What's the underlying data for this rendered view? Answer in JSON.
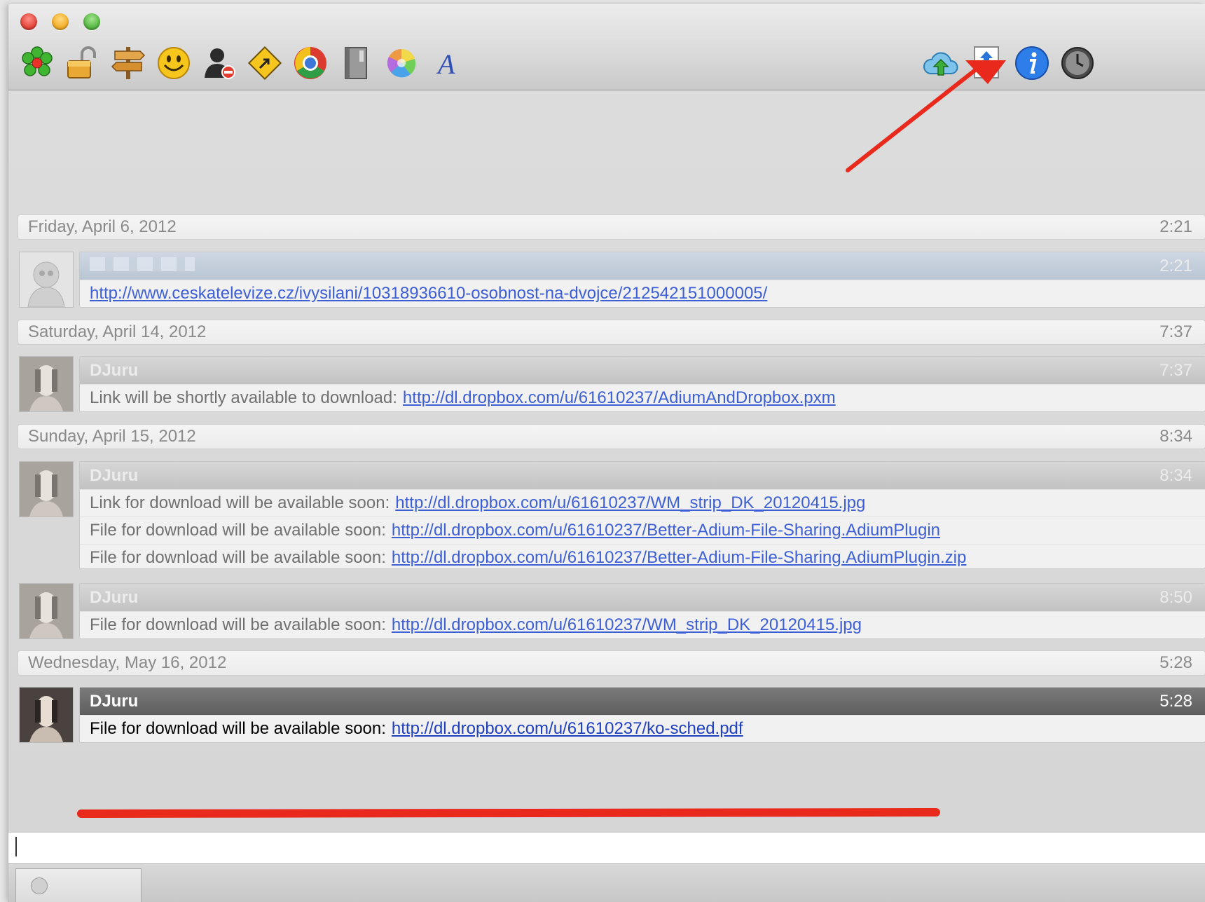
{
  "toolbar": {
    "left_icons": [
      "icq-flower-icon",
      "lock-icon",
      "signpost-icon",
      "smiley-icon",
      "block-contact-icon",
      "direction-sign-icon",
      "chrome-icon",
      "book-icon",
      "color-wheel-icon",
      "font-icon"
    ],
    "right_icons": [
      "cloud-upload-icon",
      "send-file-icon",
      "info-icon",
      "clock-icon"
    ]
  },
  "days": [
    {
      "date": "Friday, April 6, 2012",
      "time": "2:21"
    },
    {
      "date": "Saturday, April 14, 2012",
      "time": "7:37"
    },
    {
      "date": "Sunday, April 15, 2012",
      "time": "8:34"
    },
    {
      "date": "Wednesday, May 16, 2012",
      "time": "5:28"
    }
  ],
  "messages": [
    {
      "sender": "",
      "time": "2:21",
      "lines": [
        {
          "prefix": "",
          "link": "http://www.ceskatelevize.cz/ivysilani/10318936610-osobnost-na-dvojce/212542151000005/"
        }
      ]
    },
    {
      "sender": "DJuru",
      "time": "7:37",
      "lines": [
        {
          "prefix": "Link will be shortly available to download:",
          "link": "http://dl.dropbox.com/u/61610237/AdiumAndDropbox.pxm"
        }
      ]
    },
    {
      "sender": "DJuru",
      "time": "8:34",
      "lines": [
        {
          "prefix": "Link for download will be available soon:",
          "link": "http://dl.dropbox.com/u/61610237/WM_strip_DK_20120415.jpg"
        },
        {
          "prefix": "File for download will be available soon:",
          "link": "http://dl.dropbox.com/u/61610237/Better-Adium-File-Sharing.AdiumPlugin"
        },
        {
          "prefix": "File for download will be available soon:",
          "link": "http://dl.dropbox.com/u/61610237/Better-Adium-File-Sharing.AdiumPlugin.zip"
        }
      ]
    },
    {
      "sender": "DJuru",
      "time": "8:50",
      "lines": [
        {
          "prefix": "File for download will be available soon:",
          "link": "http://dl.dropbox.com/u/61610237/WM_strip_DK_20120415.jpg"
        }
      ]
    },
    {
      "sender": "DJuru",
      "time": "5:28",
      "lines": [
        {
          "prefix": "File for download will be available soon:",
          "link": "http://dl.dropbox.com/u/61610237/ko-sched.pdf"
        }
      ]
    }
  ],
  "colors": {
    "accent_link": "#3d5fd6",
    "annotation_red": "#e8291c"
  },
  "input": {
    "value": ""
  }
}
